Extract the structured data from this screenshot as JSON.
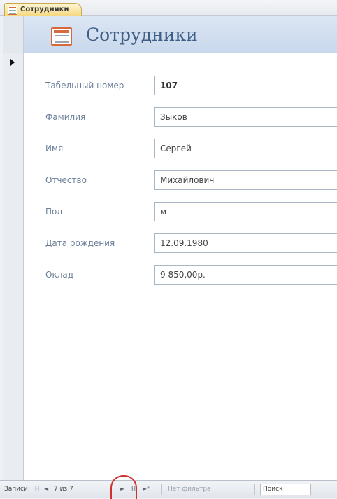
{
  "tab": {
    "label": "Сотрудники"
  },
  "header": {
    "title": "Сотрудники"
  },
  "fields": [
    {
      "label": "Табельный номер",
      "value": "107"
    },
    {
      "label": "Фамилия",
      "value": "Зыков"
    },
    {
      "label": "Имя",
      "value": "Сергей"
    },
    {
      "label": "Отчество",
      "value": "Михайлович"
    },
    {
      "label": "Пол",
      "value": "м"
    },
    {
      "label": "Дата рождения",
      "value": "12.09.1980"
    },
    {
      "label": "Оклад",
      "value": "9 850,00р."
    }
  ],
  "navbar": {
    "records_label": "Записи:",
    "first": "H",
    "prev": "◄",
    "position": "7 из 7",
    "next": "►",
    "last": "H",
    "new": "►*",
    "filter": "Нет фильтра",
    "search": "Поиск"
  }
}
